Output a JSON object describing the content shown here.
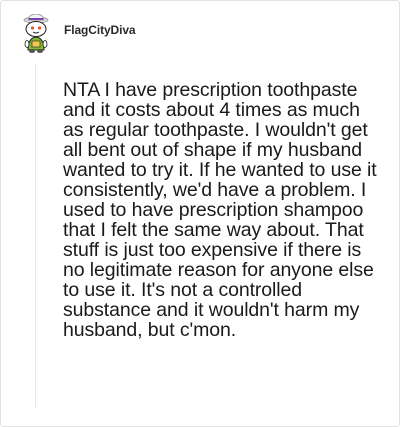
{
  "comment": {
    "author": {
      "username": "FlagCityDiva",
      "avatar_icon": "snoo-avatar-icon"
    },
    "body": "NTA I have prescription toothpaste and it costs about 4 times as much as regular toothpaste. I wouldn't get all bent out of shape if my husband wanted to try it. If he wanted to use it consistently, we'd have a problem. I used to have prescription shampoo that I felt the same way about. That stuff is just too expensive if there is no legitimate reason for anyone else to use it. It's not a controlled substance and it wouldn't harm my husband, but c'mon."
  },
  "colors": {
    "text": "#1a1a1b",
    "username": "#2b2b2b",
    "border": "#e2e2e2",
    "thread_line": "#e9e9e9"
  }
}
